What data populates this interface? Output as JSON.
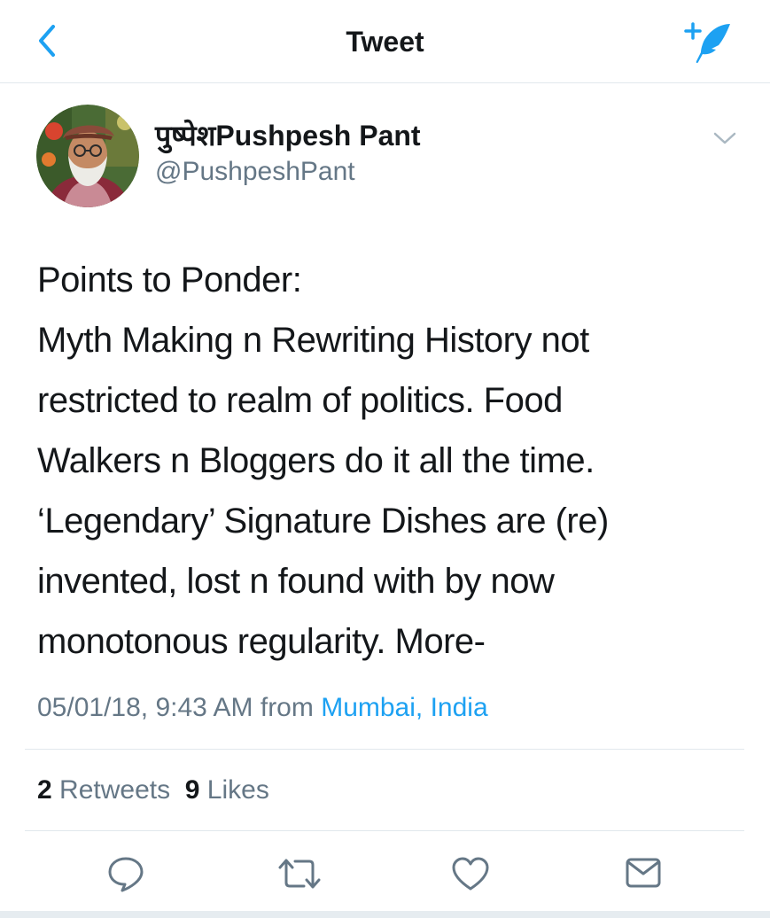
{
  "header": {
    "title": "Tweet",
    "back_icon": "chevron-left-icon",
    "compose_icon": "compose-tweet-icon",
    "accent_color": "#1da1f2"
  },
  "tweet": {
    "author": {
      "display_name": "पुष्पेशPushpesh Pant",
      "handle": "@PushpeshPant",
      "avatar": "user-avatar-photo"
    },
    "text_lines": [
      "Points to Ponder:",
      "Myth Making n Rewriting History not",
      "restricted to realm of politics. Food",
      "Walkers n Bloggers do it all the time.",
      "‘Legendary’ Signature Dishes are (re)",
      "invented, lost n found with by now",
      "monotonous regularity. More-"
    ],
    "timestamp": "05/01/18, 9:43 AM",
    "from_label": "from",
    "location": "Mumbai, India",
    "retweets_count": "2",
    "retweets_label": "Retweets",
    "likes_count": "9",
    "likes_label": "Likes"
  },
  "actions": {
    "reply_icon": "reply-icon",
    "retweet_icon": "retweet-icon",
    "like_icon": "heart-icon",
    "share_icon": "share-dm-icon"
  },
  "colors": {
    "text_primary": "#14171a",
    "text_secondary": "#657786",
    "divider": "#e1e8ed",
    "link": "#1da1f2"
  }
}
